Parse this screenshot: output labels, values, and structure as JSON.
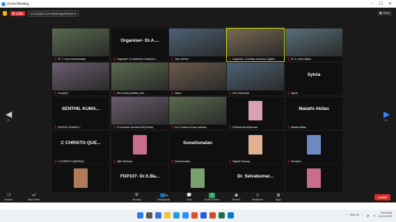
{
  "window": {
    "title": "Zoom Meeting",
    "controls": [
      "–",
      "☐",
      "✕"
    ]
  },
  "topbar": {
    "live_label": "LIVE",
    "stream_label": "on Custom Live Streaming Service",
    "view_label": "View"
  },
  "tiles": [
    {
      "name": "Dr. T. Uma Gomaneswari",
      "kind": "video"
    },
    {
      "name": "Organiser- Dr.Alwaneen Sultana A...",
      "big": "Organiser- Dr.A....",
      "kind": "text"
    },
    {
      "name": "Jasu Jilvivan",
      "kind": "video"
    },
    {
      "name": "Organiser- Dr.Kaliap Jeevaner Jogitha",
      "kind": "video",
      "active": true
    },
    {
      "name": "Dr. A. Vinai Jayam",
      "kind": "video"
    },
    {
      "name": "Yuvaraj P",
      "kind": "video"
    },
    {
      "name": "Mrs.D.Mery Melitha_Bal...",
      "kind": "video"
    },
    {
      "name": "Nisha",
      "kind": "video"
    },
    {
      "name": "Prof. Asharmila",
      "kind": "video"
    },
    {
      "name": "Sylvia",
      "big": "Sylvia",
      "kind": "text"
    },
    {
      "name": "SENTHIL KUMAR V",
      "big": "SENTHIL KUMA...",
      "kind": "text"
    },
    {
      "name": "Dr.W.Ashlin Sunitha-HOD(Trinity",
      "kind": "video"
    },
    {
      "name": "Dr.C.Zhokhra Divya Lakshmi",
      "kind": "video"
    },
    {
      "name": "Dr.Beula Senthilkumar",
      "kind": "avatar"
    },
    {
      "name": "Malathi Akilan",
      "big": "Malathi Akilan",
      "kind": "text"
    },
    {
      "name": "C CHRISTO QUEEN(L)",
      "big": "C CHRISTO QUE...",
      "kind": "text"
    },
    {
      "name": "Ajith Sindhuja",
      "kind": "avatar"
    },
    {
      "name": "SonaGunalan",
      "big": "SonaGunalan",
      "kind": "text"
    },
    {
      "name": "Rajesh Devaraj",
      "kind": "avatar"
    },
    {
      "name": "Kumaran",
      "kind": "avatar"
    },
    {
      "name": "Vinisha D",
      "kind": "avatar"
    },
    {
      "name": "FDP107- Dr.S.Bangajavalli",
      "big": "FDP107- Dr.S.Ba...",
      "kind": "text"
    },
    {
      "name": "Dr.T.N.Sathinadi",
      "kind": "avatar"
    },
    {
      "name": "Dr. Selvakumar Dharmaraj",
      "big": "Dr. Selvakumar...",
      "kind": "text"
    },
    {
      "name": "Subbu Lakshmi",
      "kind": "avatar"
    }
  ],
  "pager": {
    "left": "1/6",
    "right": "1/6"
  },
  "toolbar": {
    "unmute": "Unmute",
    "start_video": "Start Video",
    "security": "Security",
    "participants": "Participants",
    "participants_count": "50",
    "chat": "Chat",
    "share_screen": "Share Screen",
    "record": "Record",
    "reactions": "Reactions",
    "apps": "Apps",
    "leave": "Leave"
  },
  "taskbar": {
    "lang": "ENG\nIN",
    "time": "10:53 AM",
    "date": "02-03-2022"
  }
}
